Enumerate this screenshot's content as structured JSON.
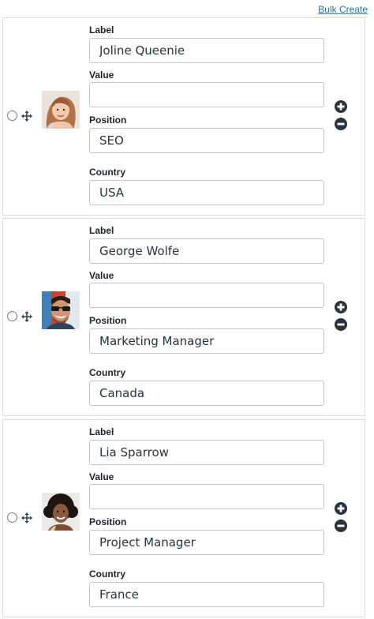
{
  "header": {
    "bulk_create_label": "Bulk Create"
  },
  "field_labels": {
    "label": "Label",
    "value": "Value",
    "position": "Position",
    "country": "Country"
  },
  "items": [
    {
      "label": "Joline Queenie",
      "value": "",
      "position": "SEO",
      "country": "USA",
      "avatar": "woman-portrait"
    },
    {
      "label": "George Wolfe",
      "value": "",
      "position": "Marketing Manager",
      "country": "Canada",
      "avatar": "man-sunglasses-portrait"
    },
    {
      "label": "Lia Sparrow",
      "value": "",
      "position": "Project Manager",
      "country": "France",
      "avatar": "woman-curly-hair-portrait"
    }
  ],
  "icons": {
    "select": "radio-icon",
    "drag": "move-icon",
    "add": "plus-circle-icon",
    "remove": "minus-circle-icon"
  },
  "colors": {
    "link": "#2271b1",
    "border": "#c3c4c7",
    "control": "#2c3338"
  }
}
